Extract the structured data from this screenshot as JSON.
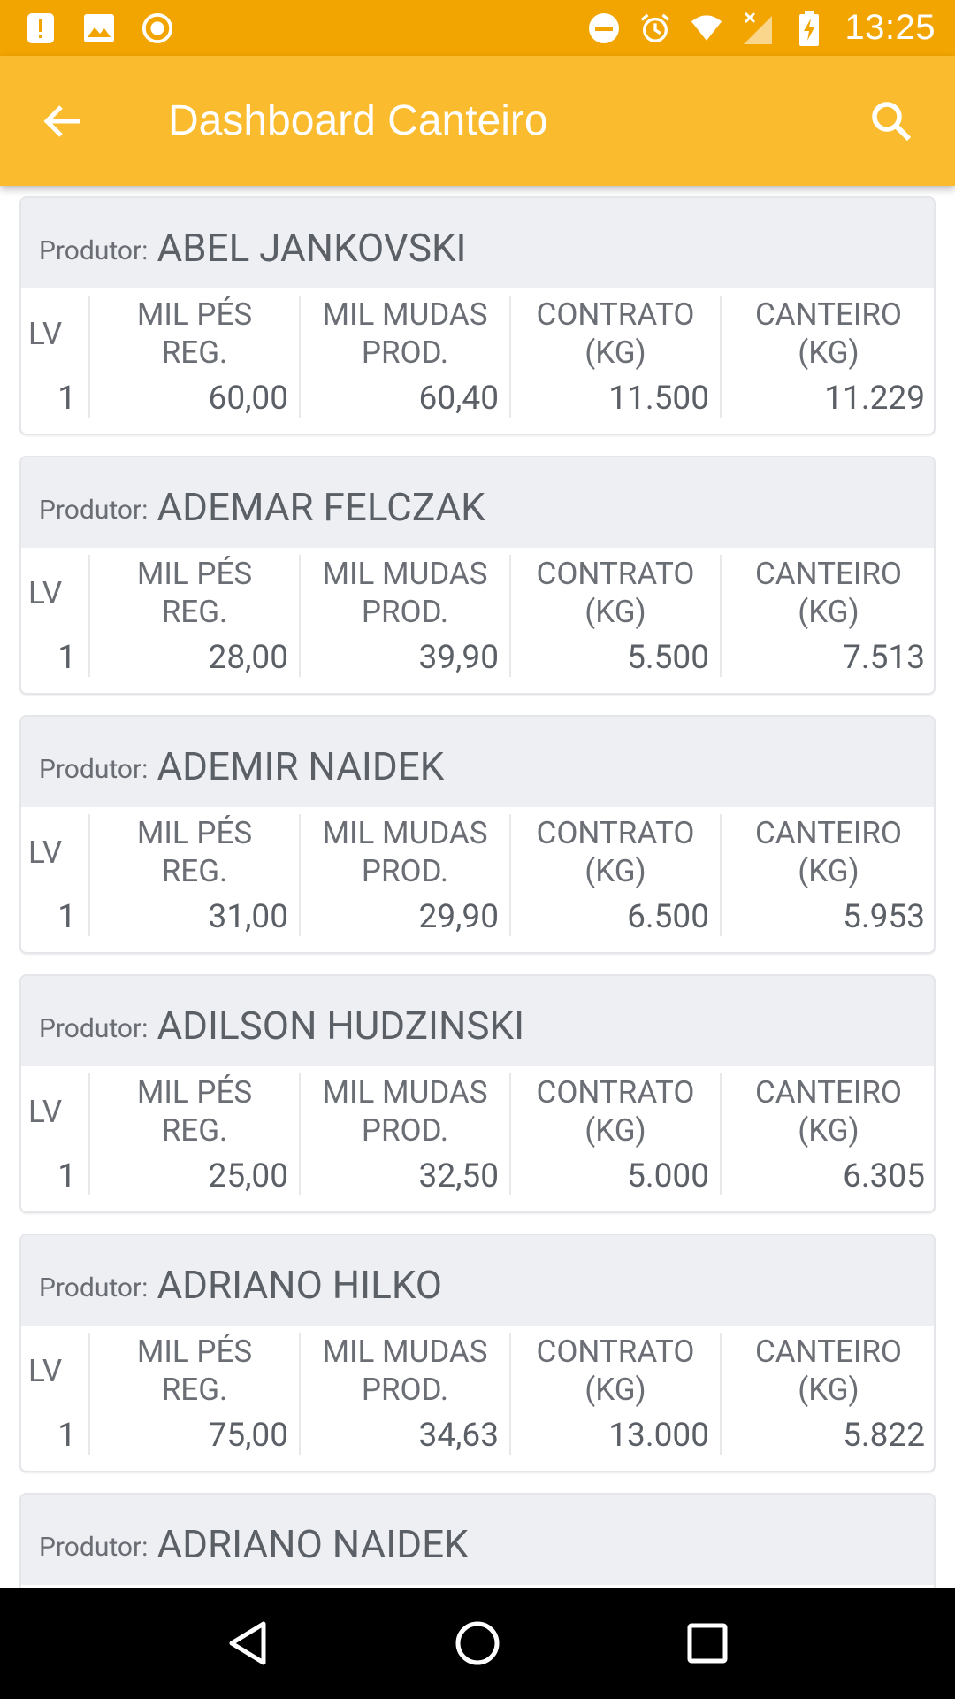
{
  "status_bar": {
    "time": "13:25",
    "icons_left": [
      "alert-icon",
      "image-icon",
      "record-icon"
    ],
    "icons_right": [
      "do-not-disturb-icon",
      "alarm-icon",
      "wifi-icon",
      "no-signal-icon",
      "battery-charging-icon"
    ]
  },
  "app_bar": {
    "title": "Dashboard Canteiro",
    "back_icon": "arrow-back-icon",
    "search_icon": "search-icon",
    "color": "#FBBB2E"
  },
  "columns": {
    "lv": "LV",
    "mil_pes_1": "MIL PÉS",
    "mil_pes_2": "REG.",
    "mil_mudas_1": "MIL MUDAS",
    "mil_mudas_2": "PROD.",
    "contrato_1": "CONTRATO",
    "contrato_2": "(KG)",
    "canteiro_1": "CANTEIRO",
    "canteiro_2": "(KG)"
  },
  "producer_label": "Produtor:",
  "producers": [
    {
      "name": "ABEL JANKOVSKI",
      "lv": "1",
      "mil_pes": "60,00",
      "mil_mudas": "60,40",
      "contrato": "11.500",
      "canteiro": "11.229"
    },
    {
      "name": "ADEMAR FELCZAK",
      "lv": "1",
      "mil_pes": "28,00",
      "mil_mudas": "39,90",
      "contrato": "5.500",
      "canteiro": "7.513"
    },
    {
      "name": "ADEMIR NAIDEK",
      "lv": "1",
      "mil_pes": "31,00",
      "mil_mudas": "29,90",
      "contrato": "6.500",
      "canteiro": "5.953"
    },
    {
      "name": "ADILSON HUDZINSKI",
      "lv": "1",
      "mil_pes": "25,00",
      "mil_mudas": "32,50",
      "contrato": "5.000",
      "canteiro": "6.305"
    },
    {
      "name": "ADRIANO HILKO",
      "lv": "1",
      "mil_pes": "75,00",
      "mil_mudas": "34,63",
      "contrato": "13.000",
      "canteiro": "5.822"
    },
    {
      "name": "ADRIANO NAIDEK"
    }
  ],
  "nav_bar": {
    "icons": [
      "back-triangle-icon",
      "home-circle-icon",
      "recents-square-icon"
    ]
  }
}
